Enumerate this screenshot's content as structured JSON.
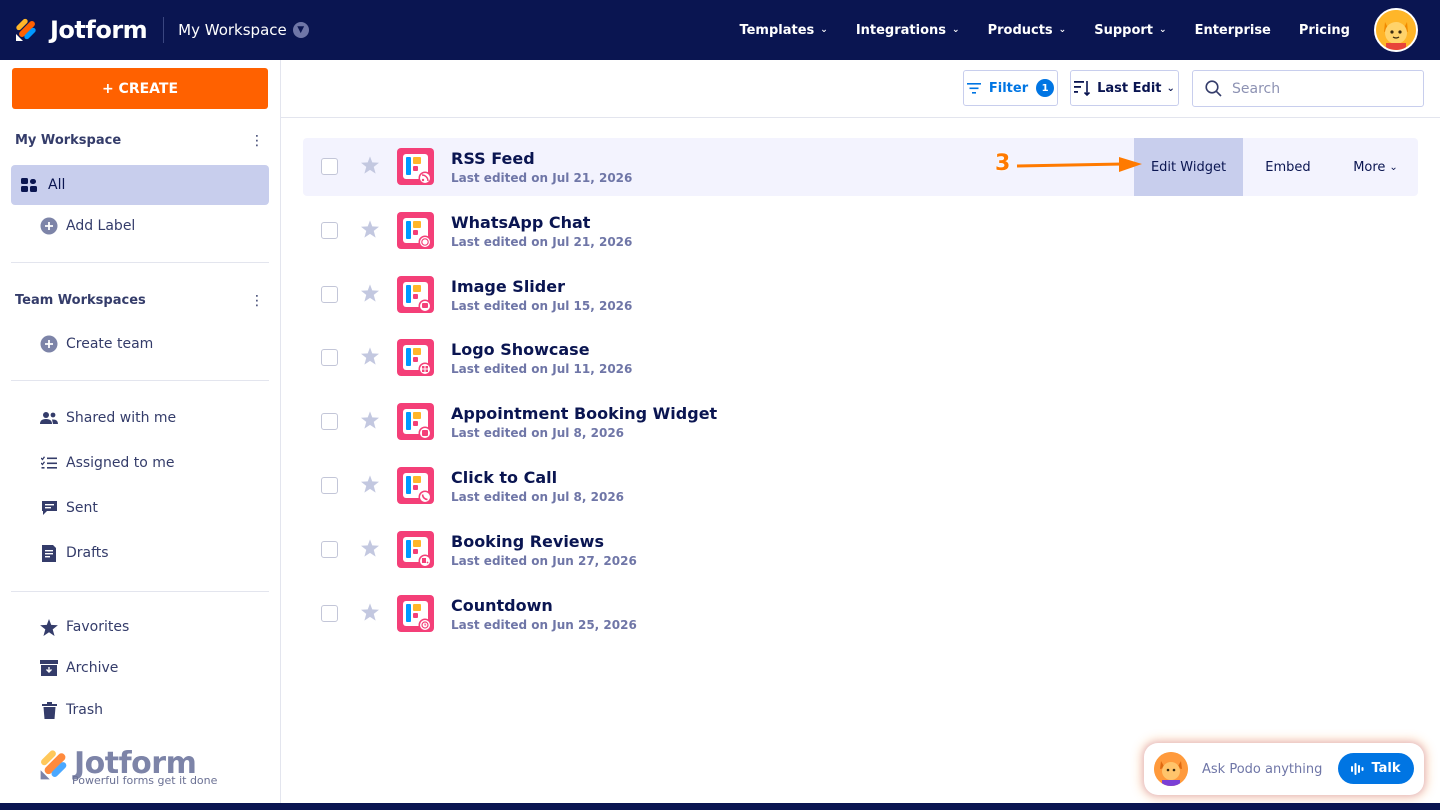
{
  "brand": {
    "name": "Jotform"
  },
  "workspace_switch": {
    "label": "My Workspace"
  },
  "nav": {
    "links": [
      {
        "label": "Templates",
        "dropdown": true
      },
      {
        "label": "Integrations",
        "dropdown": true
      },
      {
        "label": "Products",
        "dropdown": true
      },
      {
        "label": "Support",
        "dropdown": true
      },
      {
        "label": "Enterprise",
        "dropdown": false
      },
      {
        "label": "Pricing",
        "dropdown": false
      }
    ]
  },
  "sidebar": {
    "create_label": "+ CREATE",
    "my_workspace_heading": "My Workspace",
    "all_label": "All",
    "add_label": "Add Label",
    "team_heading": "Team Workspaces",
    "create_team": "Create team",
    "shared": "Shared with me",
    "assigned": "Assigned to me",
    "sent": "Sent",
    "drafts": "Drafts",
    "favorites": "Favorites",
    "archive": "Archive",
    "trash": "Trash",
    "watermark_name": "Jotform",
    "watermark_tagline": "Powerful forms get it done"
  },
  "toolbar": {
    "filter_label": "Filter",
    "filter_count": "1",
    "sort_label": "Last Edit",
    "search_placeholder": "Search"
  },
  "forms": [
    {
      "title": "RSS Feed",
      "date": "Last edited on Jul 21, 2026",
      "badge": "rss-icon"
    },
    {
      "title": "WhatsApp Chat",
      "date": "Last edited on Jul 21, 2026",
      "badge": "whatsapp-icon"
    },
    {
      "title": "Image Slider",
      "date": "Last edited on Jul 15, 2026",
      "badge": "image-icon"
    },
    {
      "title": "Logo Showcase",
      "date": "Last edited on Jul 11, 2026",
      "badge": "grid-icon"
    },
    {
      "title": "Appointment Booking Widget",
      "date": "Last edited on Jul 8, 2026",
      "badge": "calendar-icon"
    },
    {
      "title": "Click to Call",
      "date": "Last edited on Jul 8, 2026",
      "badge": "phone-icon"
    },
    {
      "title": "Booking Reviews",
      "date": "Last edited on Jun 27, 2026",
      "badge": "booking-icon"
    },
    {
      "title": "Countdown",
      "date": "Last edited on Jun 25, 2026",
      "badge": "timer-icon"
    }
  ],
  "row_actions": {
    "edit": "Edit Widget",
    "embed": "Embed",
    "more": "More"
  },
  "annotation": {
    "step": "3"
  },
  "podo": {
    "placeholder": "Ask Podo anything",
    "talk_label": "Talk"
  },
  "colors": {
    "navy": "#0a1551",
    "accent": "#ff6100",
    "blue": "#0075e3",
    "form_icon": "#f43f78",
    "selected": "#c8ceed"
  }
}
